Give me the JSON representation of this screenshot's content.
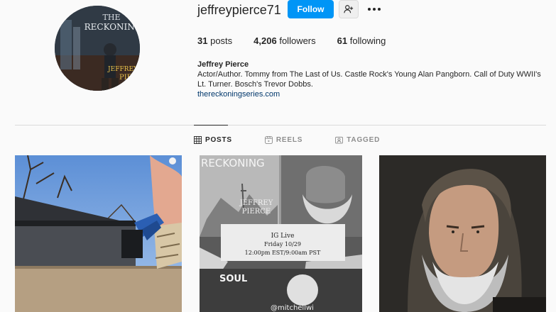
{
  "profile": {
    "username": "jeffreypierce71",
    "follow_label": "Follow",
    "stats": {
      "posts": "31",
      "posts_label": "posts",
      "followers": "4,206",
      "followers_label": "followers",
      "following": "61",
      "following_label": "following"
    },
    "bio": {
      "name": "Jeffrey Pierce",
      "text_line1": "Actor/Author. Tommy from The Last of Us. Castle Rock's Young Alan Pangborn. Call of Duty WWII's",
      "text_line2": "Lt. Turner. Bosch's Trevor Dobbs.",
      "link": "thereckoningseries.com"
    },
    "avatar_text": {
      "line1": "THE",
      "line2": "RECKONING",
      "line3": "JEFFREY",
      "line4": "PIE"
    }
  },
  "tabs": [
    {
      "label": "POSTS",
      "active": true
    },
    {
      "label": "REELS",
      "active": false
    },
    {
      "label": "TAGGED",
      "active": false
    }
  ],
  "posts": {
    "post2": {
      "title": "RECKONING",
      "author1": "JEFFREY",
      "author2": "PIERCE",
      "event_title": "IG Live",
      "event_date": "Friday 10/29",
      "event_time": "12:00pm EST/9:00am PST",
      "graffiti": "SOUL",
      "handle": "@mitchellwi"
    }
  },
  "colors": {
    "accent": "#0095f6",
    "link": "#00376b",
    "text": "#262626",
    "muted": "#8e8e8e",
    "border": "#dbdbdb"
  },
  "icons": {
    "suggest": "person-plus-icon",
    "more": "more-dots-icon",
    "posts_tab": "grid-icon",
    "reels_tab": "reels-icon",
    "tagged_tab": "tagged-icon"
  }
}
